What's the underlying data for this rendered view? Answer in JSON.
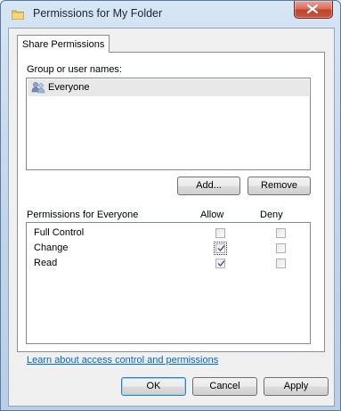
{
  "window": {
    "title": "Permissions for My Folder",
    "close_label": "Close"
  },
  "tabs": [
    {
      "label": "Share Permissions"
    }
  ],
  "group": {
    "label": "Group or user names:",
    "users": [
      {
        "name": "Everyone",
        "selected": true
      }
    ]
  },
  "buttons": {
    "add": "Add...",
    "remove": "Remove",
    "ok": "OK",
    "cancel": "Cancel",
    "apply": "Apply"
  },
  "permissions": {
    "title": "Permissions for Everyone",
    "allow_label": "Allow",
    "deny_label": "Deny",
    "rows": [
      {
        "name": "Full Control",
        "allow": false,
        "deny": false
      },
      {
        "name": "Change",
        "allow": true,
        "deny": false
      },
      {
        "name": "Read",
        "allow": true,
        "deny": false
      }
    ]
  },
  "link": {
    "text": "Learn about access control and permissions"
  },
  "colors": {
    "link": "#0066cc",
    "close_button": "#c9563e",
    "selection": "#e8e8e8"
  }
}
